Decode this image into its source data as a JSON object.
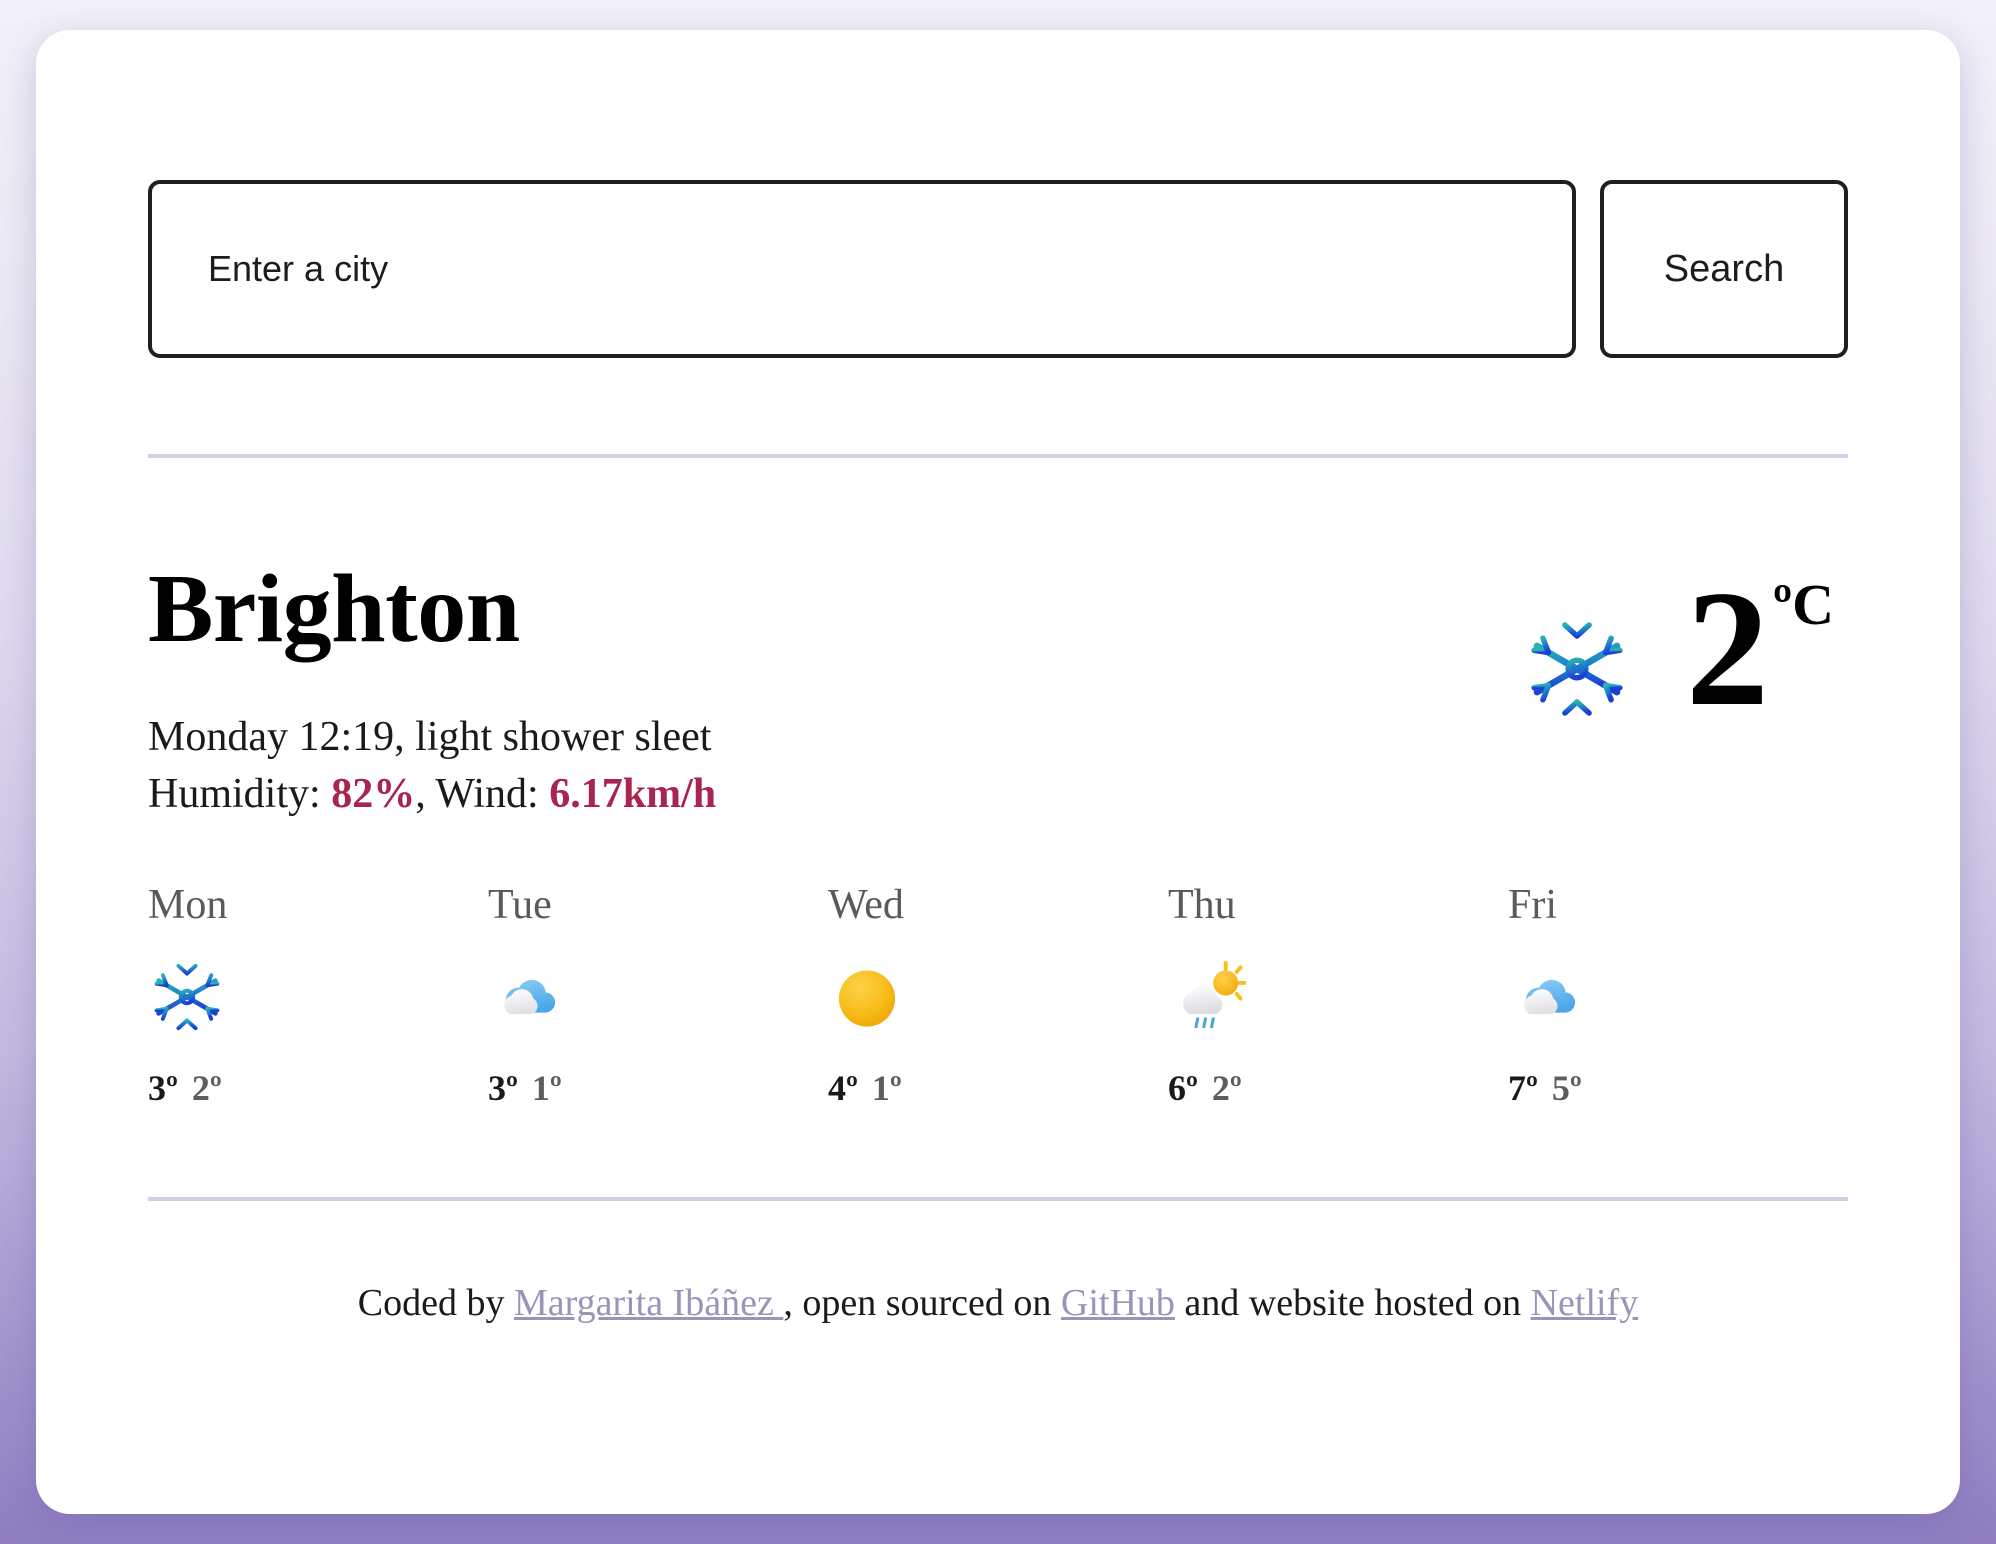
{
  "search": {
    "placeholder": "Enter a city",
    "value": "",
    "button_label": "Search"
  },
  "current": {
    "city": "Brighton",
    "conditions_line": "Monday 12:19, light shower sleet",
    "humidity_prefix": "Humidity: ",
    "humidity_value": "82%",
    "wind_prefix": ", Wind: ",
    "wind_value": "6.17km/h",
    "temperature": "2",
    "unit": "ºC",
    "icon": "snowflake-icon"
  },
  "forecast": [
    {
      "day": "Mon",
      "icon": "snowflake-icon",
      "max": "3º",
      "min": "2º"
    },
    {
      "day": "Tue",
      "icon": "cloud-icon",
      "max": "3º",
      "min": "1º"
    },
    {
      "day": "Wed",
      "icon": "sun-icon",
      "max": "4º",
      "min": "1º"
    },
    {
      "day": "Thu",
      "icon": "sun-rain-icon",
      "max": "6º",
      "min": "2º"
    },
    {
      "day": "Fri",
      "icon": "cloud-icon",
      "max": "7º",
      "min": "5º"
    }
  ],
  "footer": {
    "prefix": "Coded by ",
    "author": "Margarita Ibáñez ",
    "mid1": ", open sourced on ",
    "source": "GitHub",
    "mid2": " and website hosted on ",
    "host": "Netlify"
  },
  "colors": {
    "accent_metric": "#a8254e",
    "link": "#9a94b8",
    "divider": "#d6cde5",
    "background_top": "#f2f0f8",
    "background_bottom": "#8f7fc2",
    "snowflake_top": "#2bb3b3",
    "snowflake_bottom": "#1b50c8",
    "sun": "#f2b307"
  }
}
